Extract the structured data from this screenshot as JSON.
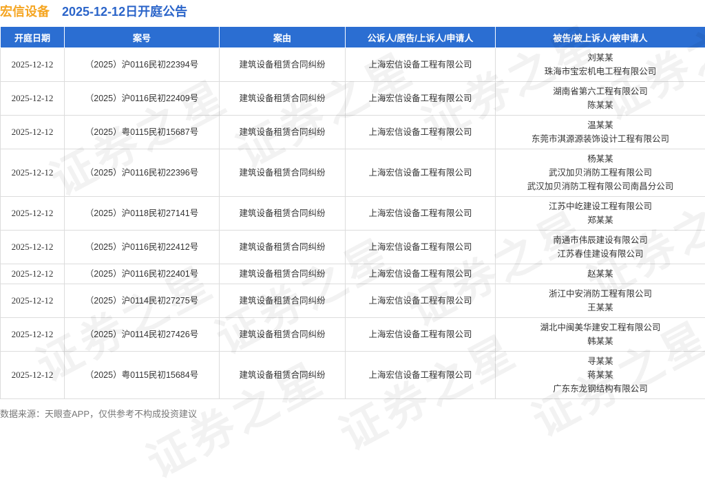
{
  "header": {
    "company": "宏信设备",
    "title": "2025-12-12日开庭公告"
  },
  "table": {
    "columns": [
      "开庭日期",
      "案号",
      "案由",
      "公诉人/原告/上诉人/申请人",
      "被告/被上诉人/被申请人"
    ],
    "rows": [
      {
        "date": "2025-12-12",
        "case_no": "（2025）沪0116民初22394号",
        "cause": "建筑设备租赁合同纠纷",
        "plaintiff": "上海宏信设备工程有限公司",
        "defendants": [
          "刘某某",
          "珠海市宝宏机电工程有限公司"
        ]
      },
      {
        "date": "2025-12-12",
        "case_no": "（2025）沪0116民初22409号",
        "cause": "建筑设备租赁合同纠纷",
        "plaintiff": "上海宏信设备工程有限公司",
        "defendants": [
          "湖南省第六工程有限公司",
          "陈某某"
        ]
      },
      {
        "date": "2025-12-12",
        "case_no": "（2025）粤0115民初15687号",
        "cause": "建筑设备租赁合同纠纷",
        "plaintiff": "上海宏信设备工程有限公司",
        "defendants": [
          "温某某",
          "东莞市淇源源装饰设计工程有限公司"
        ]
      },
      {
        "date": "2025-12-12",
        "case_no": "（2025）沪0116民初22396号",
        "cause": "建筑设备租赁合同纠纷",
        "plaintiff": "上海宏信设备工程有限公司",
        "defendants": [
          "杨某某",
          "武汉加贝消防工程有限公司",
          "武汉加贝消防工程有限公司南昌分公司"
        ]
      },
      {
        "date": "2025-12-12",
        "case_no": "（2025）沪0118民初27141号",
        "cause": "建筑设备租赁合同纠纷",
        "plaintiff": "上海宏信设备工程有限公司",
        "defendants": [
          "江苏中屹建设工程有限公司",
          "郑某某"
        ]
      },
      {
        "date": "2025-12-12",
        "case_no": "（2025）沪0116民初22412号",
        "cause": "建筑设备租赁合同纠纷",
        "plaintiff": "上海宏信设备工程有限公司",
        "defendants": [
          "南通市伟辰建设有限公司",
          "江苏春佳建设有限公司"
        ]
      },
      {
        "date": "2025-12-12",
        "case_no": "（2025）沪0116民初22401号",
        "cause": "建筑设备租赁合同纠纷",
        "plaintiff": "上海宏信设备工程有限公司",
        "defendants": [
          "赵某某"
        ]
      },
      {
        "date": "2025-12-12",
        "case_no": "（2025）沪0114民初27275号",
        "cause": "建筑设备租赁合同纠纷",
        "plaintiff": "上海宏信设备工程有限公司",
        "defendants": [
          "浙江中安消防工程有限公司",
          "王某某"
        ]
      },
      {
        "date": "2025-12-12",
        "case_no": "（2025）沪0114民初27426号",
        "cause": "建筑设备租赁合同纠纷",
        "plaintiff": "上海宏信设备工程有限公司",
        "defendants": [
          "湖北中闽美华建安工程有限公司",
          "韩某某"
        ]
      },
      {
        "date": "2025-12-12",
        "case_no": "（2025）粤0115民初15684号",
        "cause": "建筑设备租赁合同纠纷",
        "plaintiff": "上海宏信设备工程有限公司",
        "defendants": [
          "寻某某",
          "蒋某某",
          "广东东龙钢结构有限公司"
        ]
      }
    ]
  },
  "watermark": "证券之星",
  "footer": "数据来源：天眼查APP，仅供参考不构成投资建议",
  "colors": {
    "company": "#f5a623",
    "title": "#2a64c9",
    "header_bg": "#2b6ed2"
  }
}
